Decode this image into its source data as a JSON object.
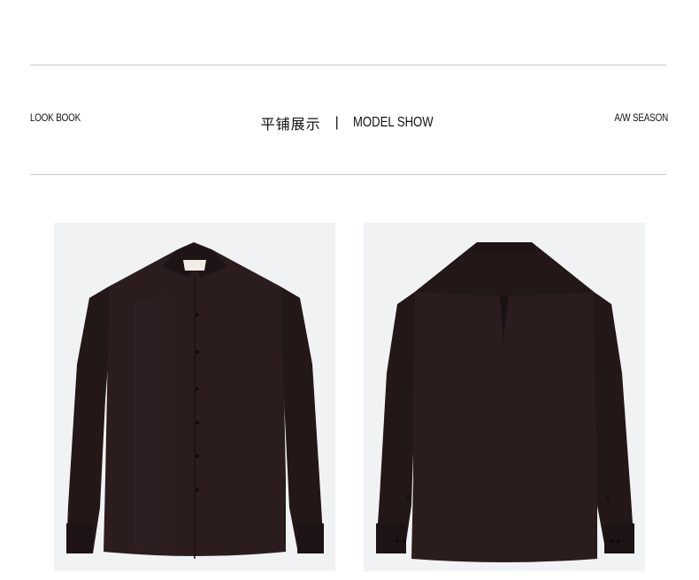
{
  "header": {
    "left_label": "LOOK BOOK",
    "center_cn": "平铺展示",
    "separator": "|",
    "center_en": "MODEL SHOW",
    "right_label": "A/W SEASON"
  },
  "gallery": {
    "items": [
      {
        "view": "front",
        "shirt_color": "#2a1c1d"
      },
      {
        "view": "back",
        "shirt_color": "#2a1c1d"
      }
    ]
  }
}
